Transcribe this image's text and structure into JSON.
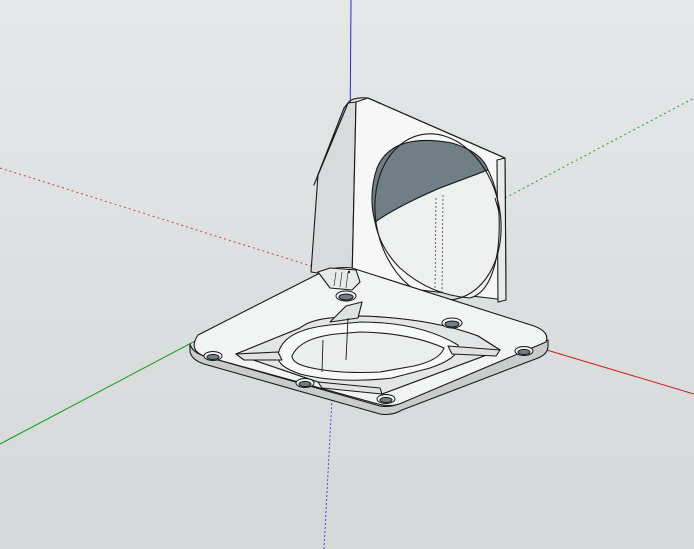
{
  "viewport": {
    "background_color": "#dfe2e3"
  },
  "axes": {
    "red": {
      "color": "#cc2222",
      "icon": "red-axis-line"
    },
    "green": {
      "color": "#1a9a1a",
      "icon": "green-axis-line"
    },
    "blue": {
      "color": "#2222cc",
      "icon": "blue-axis-line"
    }
  },
  "model": {
    "face_color": "#ffffff",
    "shade_color": "#e2e4e5",
    "dark_color": "#6b7b80",
    "edge_color": "#1a1a1a",
    "parts": [
      "fan-duct-body",
      "mounting-flange",
      "screw-hole",
      "circular-opening"
    ]
  }
}
